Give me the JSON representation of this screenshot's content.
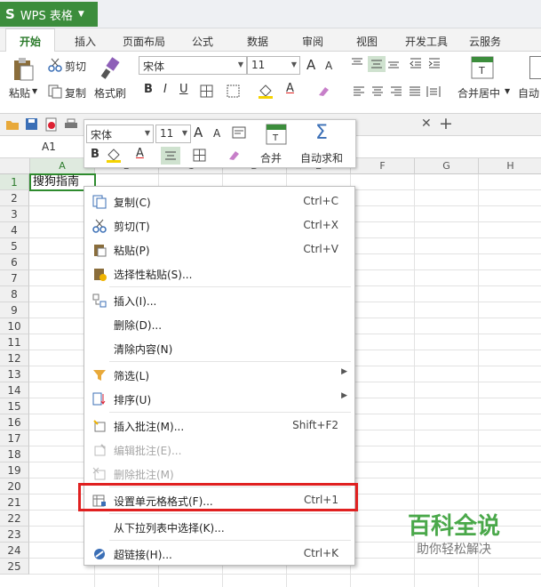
{
  "app": {
    "logo": "S",
    "title": "WPS 表格"
  },
  "tabs": [
    "开始",
    "插入",
    "页面布局",
    "公式",
    "数据",
    "审阅",
    "视图",
    "开发工具",
    "云服务"
  ],
  "ribbon": {
    "paste": "粘贴",
    "cut": "剪切",
    "copy": "复制",
    "format_brush": "格式刷",
    "font_name": "宋体",
    "font_size": "11",
    "bold": "B",
    "italic": "I",
    "underline": "U",
    "font_color_letter": "A",
    "grow": "A",
    "shrink": "A",
    "merge_center": "合并居中",
    "auto_wrap": "自动"
  },
  "formula": {
    "cell_ref": "A1"
  },
  "columns": [
    "A",
    "B",
    "C",
    "D",
    "E",
    "F",
    "G",
    "H"
  ],
  "rows": [
    "1",
    "2",
    "3",
    "4",
    "5",
    "6",
    "7",
    "8",
    "9",
    "10",
    "11",
    "12",
    "13",
    "14",
    "15",
    "16",
    "17",
    "18",
    "19",
    "20",
    "21",
    "22",
    "23",
    "24",
    "25"
  ],
  "cells": {
    "A1": "搜狗指南"
  },
  "mini_toolbar": {
    "font_name": "宋体",
    "font_size": "11",
    "merge": "合并",
    "autosum": "自动求和",
    "bold": "B",
    "font_color": "A"
  },
  "context_menu": [
    {
      "label": "复制(C)",
      "shortcut": "Ctrl+C",
      "icon": "copy-icon",
      "disabled": false,
      "submenu": false
    },
    {
      "label": "剪切(T)",
      "shortcut": "Ctrl+X",
      "icon": "scissors-icon",
      "disabled": false,
      "submenu": false
    },
    {
      "label": "粘贴(P)",
      "shortcut": "Ctrl+V",
      "icon": "paste-icon",
      "disabled": false,
      "submenu": false
    },
    {
      "label": "选择性粘贴(S)...",
      "shortcut": "",
      "icon": "paste-special-icon",
      "disabled": false,
      "submenu": false
    },
    {
      "label": "插入(I)...",
      "shortcut": "",
      "icon": "insert-icon",
      "disabled": false,
      "submenu": false
    },
    {
      "label": "删除(D)...",
      "shortcut": "",
      "icon": "",
      "disabled": false,
      "submenu": false
    },
    {
      "label": "清除内容(N)",
      "shortcut": "",
      "icon": "",
      "disabled": false,
      "submenu": false
    },
    {
      "label": "筛选(L)",
      "shortcut": "",
      "icon": "filter-icon",
      "disabled": false,
      "submenu": true
    },
    {
      "label": "排序(U)",
      "shortcut": "",
      "icon": "sort-icon",
      "disabled": false,
      "submenu": true
    },
    {
      "label": "插入批注(M)...",
      "shortcut": "Shift+F2",
      "icon": "insert-comment-icon",
      "disabled": false,
      "submenu": false
    },
    {
      "label": "编辑批注(E)...",
      "shortcut": "",
      "icon": "edit-comment-icon",
      "disabled": true,
      "submenu": false
    },
    {
      "label": "删除批注(M)",
      "shortcut": "",
      "icon": "delete-comment-icon",
      "disabled": true,
      "submenu": false
    },
    {
      "label": "设置单元格格式(F)...",
      "shortcut": "Ctrl+1",
      "icon": "format-cells-icon",
      "disabled": false,
      "submenu": false
    },
    {
      "label": "从下拉列表中选择(K)...",
      "shortcut": "",
      "icon": "",
      "disabled": false,
      "submenu": false
    },
    {
      "label": "超链接(H)...",
      "shortcut": "Ctrl+K",
      "icon": "hyperlink-icon",
      "disabled": false,
      "submenu": false
    }
  ],
  "watermark": {
    "title": "百科全说",
    "subtitle": "助你轻松解决"
  },
  "colors": {
    "brand": "#3c8d3c",
    "highlight": "#e02020",
    "selection": "#2e8b2e"
  }
}
